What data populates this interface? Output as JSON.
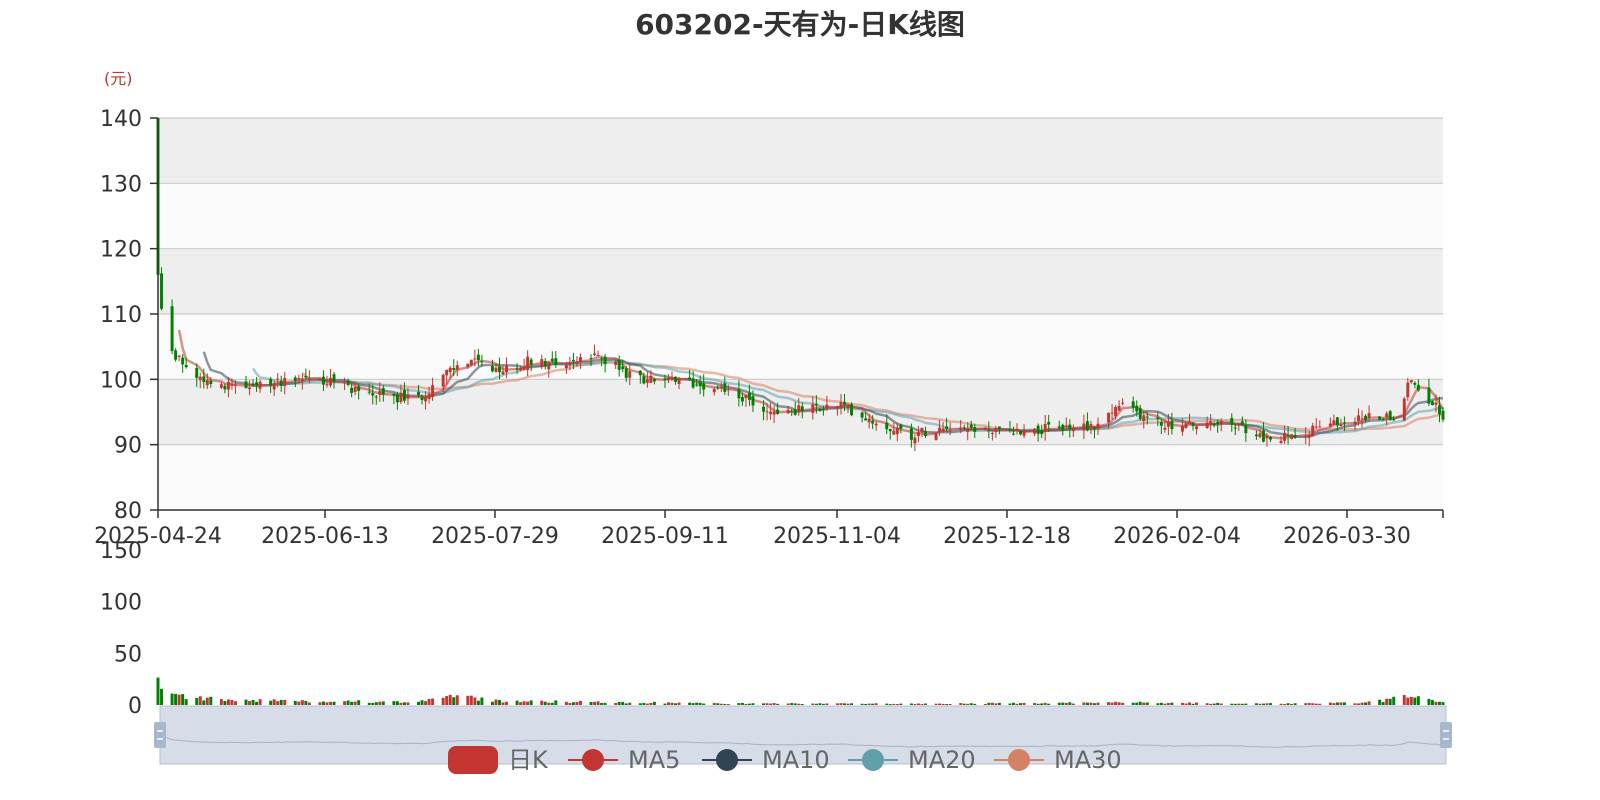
{
  "chart_data": {
    "type": "candlestick",
    "title": "603202-天有为-日K线图",
    "y_unit_label": "(元)",
    "price_axis": {
      "ylim": [
        80,
        140
      ],
      "ticks": [
        80,
        90,
        100,
        110,
        120,
        130,
        140
      ]
    },
    "volume_axis": {
      "ylim": [
        0,
        150
      ],
      "ticks": [
        0,
        50,
        100,
        150
      ]
    },
    "x_ticks": [
      "2025-04-24",
      "2025-06-13",
      "2025-07-29",
      "2025-09-11",
      "2025-11-04",
      "2025-12-18",
      "2026-02-04",
      "2026-03-30"
    ],
    "x_range": [
      "2025-04-24",
      "2026-04-24"
    ],
    "legend": [
      {
        "label": "日K",
        "color": "#c23531",
        "shape": "rect"
      },
      {
        "label": "MA5",
        "color": "#c23531",
        "shape": "circle"
      },
      {
        "label": "MA10",
        "color": "#2f4554",
        "shape": "circle"
      },
      {
        "label": "MA20",
        "color": "#61a0a8",
        "shape": "circle"
      },
      {
        "label": "MA30",
        "color": "#d48265",
        "shape": "circle"
      }
    ],
    "colors": {
      "up": "#c23531",
      "down": "#008000",
      "ma5": "#c23531",
      "ma10": "#2f4554",
      "ma20": "#61a0a8",
      "ma30": "#d48265"
    },
    "close_anchors": [
      {
        "date": "2025-04-24",
        "close": 116
      },
      {
        "date": "2025-04-25",
        "close": 110
      },
      {
        "date": "2025-04-28",
        "close": 104
      },
      {
        "date": "2025-05-06",
        "close": 100
      },
      {
        "date": "2025-05-20",
        "close": 98.5
      },
      {
        "date": "2025-06-03",
        "close": 100.5
      },
      {
        "date": "2025-06-13",
        "close": 99.5
      },
      {
        "date": "2025-06-25",
        "close": 97.5
      },
      {
        "date": "2025-07-07",
        "close": 97
      },
      {
        "date": "2025-07-15",
        "close": 101
      },
      {
        "date": "2025-07-22",
        "close": 103
      },
      {
        "date": "2025-07-29",
        "close": 101
      },
      {
        "date": "2025-08-08",
        "close": 103
      },
      {
        "date": "2025-08-18",
        "close": 102.5
      },
      {
        "date": "2025-08-28",
        "close": 103.5
      },
      {
        "date": "2025-09-05",
        "close": 100.5
      },
      {
        "date": "2025-09-11",
        "close": 100
      },
      {
        "date": "2025-09-30",
        "close": 99
      },
      {
        "date": "2025-10-15",
        "close": 95
      },
      {
        "date": "2025-10-27",
        "close": 95.5
      },
      {
        "date": "2025-11-04",
        "close": 96
      },
      {
        "date": "2025-11-14",
        "close": 93.5
      },
      {
        "date": "2025-11-24",
        "close": 91.5
      },
      {
        "date": "2025-12-04",
        "close": 93
      },
      {
        "date": "2025-12-18",
        "close": 92
      },
      {
        "date": "2026-01-05",
        "close": 92.5
      },
      {
        "date": "2026-01-16",
        "close": 93
      },
      {
        "date": "2026-01-22",
        "close": 96
      },
      {
        "date": "2026-02-04",
        "close": 93
      },
      {
        "date": "2026-02-24",
        "close": 93
      },
      {
        "date": "2026-03-06",
        "close": 90.5
      },
      {
        "date": "2026-03-18",
        "close": 92.5
      },
      {
        "date": "2026-03-30",
        "close": 94
      },
      {
        "date": "2026-04-10",
        "close": 94.5
      },
      {
        "date": "2026-04-15",
        "close": 100
      },
      {
        "date": "2026-04-20",
        "close": 97
      },
      {
        "date": "2026-04-24",
        "close": 94.5
      }
    ],
    "volume_anchors": [
      {
        "date": "2025-04-24",
        "volume": 24
      },
      {
        "date": "2025-04-25",
        "volume": 12
      },
      {
        "date": "2025-04-28",
        "volume": 9
      },
      {
        "date": "2025-05-12",
        "volume": 5
      },
      {
        "date": "2025-06-05",
        "volume": 4
      },
      {
        "date": "2025-07-03",
        "volume": 3
      },
      {
        "date": "2025-07-18",
        "volume": 8
      },
      {
        "date": "2025-07-29",
        "volume": 4
      },
      {
        "date": "2025-08-20",
        "volume": 3
      },
      {
        "date": "2025-10-01",
        "volume": 1.5
      },
      {
        "date": "2025-12-01",
        "volume": 1.2
      },
      {
        "date": "2026-01-22",
        "volume": 2.5
      },
      {
        "date": "2026-03-01",
        "volume": 1.2
      },
      {
        "date": "2026-04-01",
        "volume": 2
      },
      {
        "date": "2026-04-15",
        "volume": 8
      },
      {
        "date": "2026-04-24",
        "volume": 2
      }
    ]
  }
}
